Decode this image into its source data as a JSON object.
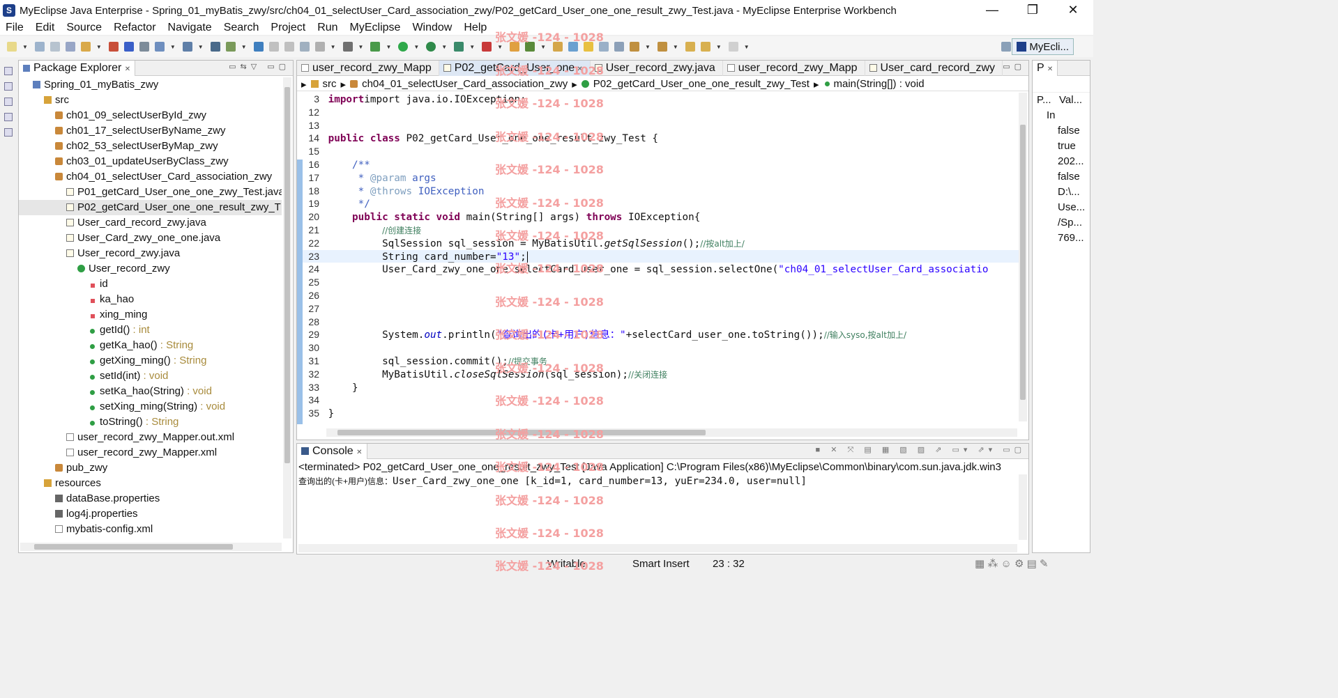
{
  "window": {
    "title": "MyEclipse Java Enterprise - Spring_01_myBatis_zwy/src/ch04_01_selectUser_Card_association_zwy/P02_getCard_User_one_one_result_zwy_Test.java - MyEclipse Enterprise Workbench",
    "minimize": "—",
    "maximize": "❐",
    "close": "✕"
  },
  "menu": [
    "File",
    "Edit",
    "Source",
    "Refactor",
    "Navigate",
    "Search",
    "Project",
    "Run",
    "MyEclipse",
    "Window",
    "Help"
  ],
  "perspective": "MyEcli...",
  "explorer": {
    "title": "Package Explorer",
    "items": [
      {
        "label": "Spring_01_myBatis_zwy",
        "type": ""
      },
      {
        "label": "src",
        "type": ""
      },
      {
        "label": "ch01_09_selectUserById_zwy",
        "type": ""
      },
      {
        "label": "ch01_17_selectUserByName_zwy",
        "type": ""
      },
      {
        "label": "ch02_53_selectUserByMap_zwy",
        "type": ""
      },
      {
        "label": "ch03_01_updateUserByClass_zwy",
        "type": ""
      },
      {
        "label": "ch04_01_selectUser_Card_association_zwy",
        "type": ""
      },
      {
        "label": "P01_getCard_User_one_one_zwy_Test.java",
        "type": ""
      },
      {
        "label": "P02_getCard_User_one_one_result_zwy_T",
        "type": ""
      },
      {
        "label": "User_card_record_zwy.java",
        "type": ""
      },
      {
        "label": "User_Card_zwy_one_one.java",
        "type": ""
      },
      {
        "label": "User_record_zwy.java",
        "type": ""
      },
      {
        "label": "User_record_zwy",
        "type": ""
      },
      {
        "label": "id",
        "type": ""
      },
      {
        "label": "ka_hao",
        "type": ""
      },
      {
        "label": "xing_ming",
        "type": ""
      },
      {
        "label": "getId()",
        "type": " : int"
      },
      {
        "label": "getKa_hao()",
        "type": " : String"
      },
      {
        "label": "getXing_ming()",
        "type": " : String"
      },
      {
        "label": "setId(int)",
        "type": " : void"
      },
      {
        "label": "setKa_hao(String)",
        "type": " : void"
      },
      {
        "label": "setXing_ming(String)",
        "type": " : void"
      },
      {
        "label": "toString()",
        "type": " : String"
      },
      {
        "label": "user_record_zwy_Mapper.out.xml",
        "type": ""
      },
      {
        "label": "user_record_zwy_Mapper.xml",
        "type": ""
      },
      {
        "label": "pub_zwy",
        "type": ""
      },
      {
        "label": "resources",
        "type": ""
      },
      {
        "label": "dataBase.properties",
        "type": ""
      },
      {
        "label": "log4j.properties",
        "type": ""
      },
      {
        "label": "mybatis-config.xml",
        "type": ""
      }
    ]
  },
  "editor": {
    "tabs": [
      "user_record_zwy_Mapp",
      "P02_getCard_User_one",
      "User_record_zwy.java",
      "user_record_zwy_Mapp",
      "User_card_record_zwy"
    ],
    "breadcrumb": [
      "src",
      "ch04_01_selectUser_Card_association_zwy",
      "P02_getCard_User_one_one_result_zwy_Test",
      "main(String[]) : void"
    ],
    "line_numbers": [
      "3",
      "12",
      "13",
      "14",
      "15",
      "16",
      "17",
      "18",
      "19",
      "20",
      "21",
      "22",
      "23",
      "24",
      "25",
      "26",
      "27",
      "28",
      "29",
      "30",
      "31",
      "32",
      "33",
      "34",
      "35"
    ],
    "code": {
      "l3": "import java.io.IOException;",
      "l14a": "public class ",
      "l14b": "P02_getCard_User_one_one_result_zwy_Test {",
      "l16": "/**",
      "l17a": " * ",
      "l17b": "@param",
      "l17c": " args",
      "l18a": " * ",
      "l18b": "@throws",
      "l18c": " IOException",
      "l19": " */",
      "l20a": "public static void ",
      "l20b": "main(String[] args) ",
      "l20c": "throws",
      "l20d": " IOException{",
      "l21": "//创建连接",
      "l22a": "SqlSession sql_session = MyBatisUtil.",
      "l22b": "getSqlSession",
      "l22c": "();",
      "l22d": "//按alt加上/",
      "l23a": "String card_number=",
      "l23b": "\"13\"",
      "l23c": ";",
      "l24a": "User_Card_zwy_one_one selectCard_user_one = sql_session.selectOne(",
      "l24b": "\"ch04_01_selectUser_Card_associatio",
      "l29a": "System.",
      "l29b": "out",
      "l29c": ".println(",
      "l29d": "\"查询出的(卡+用户)信息：\"",
      "l29e": "+selectCard_user_one.toString());",
      "l29f": "//输入syso,按alt加上/",
      "l31a": "sql_session.commit();",
      "l31b": "//提交事务",
      "l32a": "MyBatisUtil.",
      "l32b": "closeSqlSession",
      "l32c": "(sql_session);",
      "l32d": "//关闭连接",
      "l33": "}",
      "l35": "}"
    }
  },
  "console": {
    "title": "Console",
    "terminated": "<terminated> P02_getCard_User_one_one_result_zwy_Test [Java Application] C:\\Program Files(x86)\\MyEclipse\\Common\\binary\\com.sun.java.jdk.win3",
    "output_prefix": "查询出的(卡+用户)信息：",
    "output": "User_Card_zwy_one_one [k_id=1, card_number=13, yuEr=234.0, user=null]"
  },
  "properties": {
    "tab": "P",
    "col1": "P...",
    "col2": "Val...",
    "group": "In",
    "values": [
      "false",
      "true",
      "202...",
      "false",
      "D:\\...",
      "Use...",
      "/Sp...",
      "769..."
    ]
  },
  "status": {
    "writable": "Writable",
    "insert_mode": "Smart Insert",
    "position": "23 : 32"
  },
  "watermark": "张文媛 -124 - 1028",
  "colors": {
    "keyword": "#7f0055",
    "comment": "#3f7f5f",
    "javadoc": "#3f5fbf",
    "string": "#2a00ff",
    "watermark": "#f4a0a0"
  }
}
